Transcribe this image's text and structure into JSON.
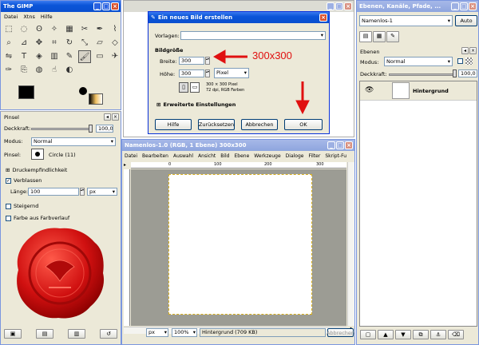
{
  "toolbox": {
    "title": "The GIMP",
    "menu": [
      "Datei",
      "Xtns",
      "Hilfe"
    ],
    "tools": [
      "rect-select-icon",
      "ellipse-select-icon",
      "lasso-icon",
      "fuzzy-select-icon",
      "color-select-icon",
      "scissors-icon",
      "paths-icon",
      "color-picker-icon",
      "zoom-icon",
      "measure-icon",
      "move-icon",
      "crop-icon",
      "rotate-icon",
      "scale-icon",
      "shear-icon",
      "perspective-icon",
      "flip-icon",
      "text-icon",
      "bucket-fill-icon",
      "blend-icon",
      "pencil-icon",
      "paintbrush-icon",
      "eraser-icon",
      "airbrush-icon",
      "ink-icon",
      "clone-icon",
      "convolve-icon",
      "smudge-icon",
      "dodge-burn-icon"
    ]
  },
  "brush_options": {
    "title": "Pinsel",
    "opacity_label": "Deckkraft:",
    "opacity_value": "100,0",
    "mode_label": "Modus:",
    "mode_value": "Normal",
    "brush_label": "Pinsel:",
    "brush_name": "Circle (11)",
    "pressure_label": "Druckempfindlichkeit",
    "fade_label": "Verblassen",
    "length_label": "Länge:",
    "length_value": "100",
    "unit": "px",
    "incremental_label": "Steigernd",
    "gradient_label": "Farbe aus Farbverlauf"
  },
  "dialog": {
    "title": "Ein neues Bild erstellen",
    "template_label": "Vorlagen:",
    "size_label": "Bildgröße",
    "width_label": "Breite:",
    "width_value": "300",
    "height_label": "Höhe:",
    "height_value": "300",
    "unit_value": "Pixel",
    "info_line1": "300 × 300 Pixel",
    "info_line2": "72 dpi, RGB Farben",
    "advanced_label": "Erweiterte Einstellungen",
    "buttons": {
      "help": "Hilfe",
      "reset": "Zurücksetzen",
      "cancel": "Abbrechen",
      "ok": "OK"
    }
  },
  "annotation": {
    "text": "300x300",
    "color": "#e01010"
  },
  "image_window": {
    "title": "Namenlos-1.0 (RGB, 1 Ebene) 300x300",
    "menu": [
      "Datei",
      "Bearbeiten",
      "Auswahl",
      "Ansicht",
      "Bild",
      "Ebene",
      "Werkzeuge",
      "Dialoge",
      "Filter",
      "Skript-Fu"
    ],
    "ruler_ticks": [
      "0",
      "100",
      "200",
      "300"
    ],
    "unit": "px",
    "zoom": "100%",
    "status": "Hintergrund (709 KB)",
    "cancel": "Abbrechen"
  },
  "layers_window": {
    "title": "Ebenen, Kanäle, Pfade, ...",
    "image_name": "Namenlos-1",
    "auto_label": "Auto",
    "panel_title": "Ebenen",
    "mode_label": "Modus:",
    "mode_value": "Normal",
    "opacity_label": "Deckkraft:",
    "opacity_value": "100,0",
    "layer_name": "Hintergrund"
  }
}
